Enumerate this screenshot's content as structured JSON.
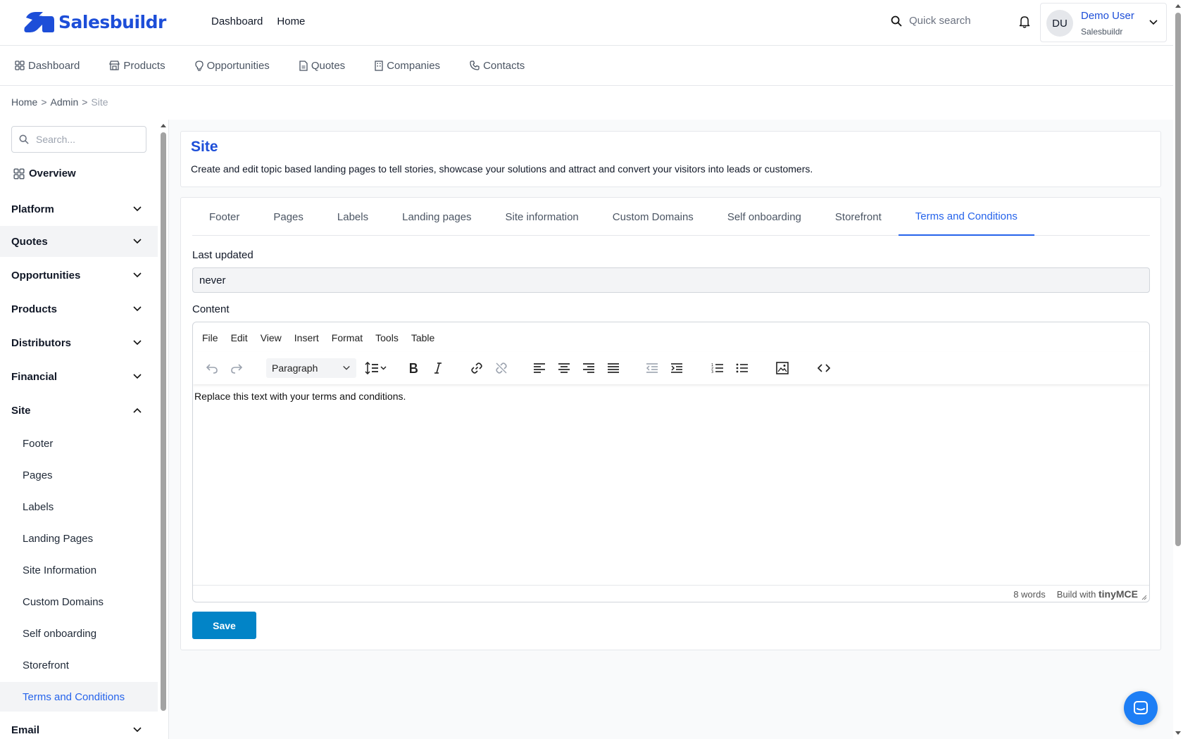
{
  "app": {
    "brand": "Salesbuildr"
  },
  "topnav": {
    "items": [
      "Dashboard",
      "Home"
    ]
  },
  "search": {
    "placeholder": "Quick search"
  },
  "user": {
    "initials": "DU",
    "name": "Demo User",
    "org": "Salesbuildr"
  },
  "modnav": {
    "items": [
      {
        "label": "Dashboard",
        "icon": "grid-icon"
      },
      {
        "label": "Products",
        "icon": "store-icon"
      },
      {
        "label": "Opportunities",
        "icon": "lightbulb-icon"
      },
      {
        "label": "Quotes",
        "icon": "document-icon"
      },
      {
        "label": "Companies",
        "icon": "building-icon"
      },
      {
        "label": "Contacts",
        "icon": "phone-icon"
      }
    ]
  },
  "breadcrumb": {
    "home": "Home",
    "admin": "Admin",
    "current": "Site",
    "sep": ">"
  },
  "sidebar": {
    "search_placeholder": "Search...",
    "overview": "Overview",
    "groups": [
      "Platform",
      "Quotes",
      "Opportunities",
      "Products",
      "Distributors",
      "Financial",
      "Site",
      "Email"
    ],
    "site_items": [
      "Footer",
      "Pages",
      "Labels",
      "Landing Pages",
      "Site Information",
      "Custom Domains",
      "Self onboarding",
      "Storefront",
      "Terms and Conditions"
    ],
    "active_item": "Terms and Conditions"
  },
  "site": {
    "title": "Site",
    "description": "Create and edit topic based landing pages to tell stories, showcase your solutions and attract and convert your visitors into leads or customers."
  },
  "tabs": [
    "Footer",
    "Pages",
    "Labels",
    "Landing pages",
    "Site information",
    "Custom Domains",
    "Self onboarding",
    "Storefront",
    "Terms and Conditions"
  ],
  "active_tab": "Terms and Conditions",
  "form": {
    "last_updated_label": "Last updated",
    "last_updated_value": "never",
    "content_label": "Content",
    "save_label": "Save"
  },
  "editor": {
    "menu": [
      "File",
      "Edit",
      "View",
      "Insert",
      "Format",
      "Tools",
      "Table"
    ],
    "block_format": "Paragraph",
    "content": "Replace this text with your terms and conditions.",
    "word_count": "8 words",
    "build_with": "Build with",
    "brand": "tinyMCE"
  },
  "colors": {
    "brand": "#1d4ed8",
    "accent": "#2563eb",
    "save": "#0284c7"
  }
}
